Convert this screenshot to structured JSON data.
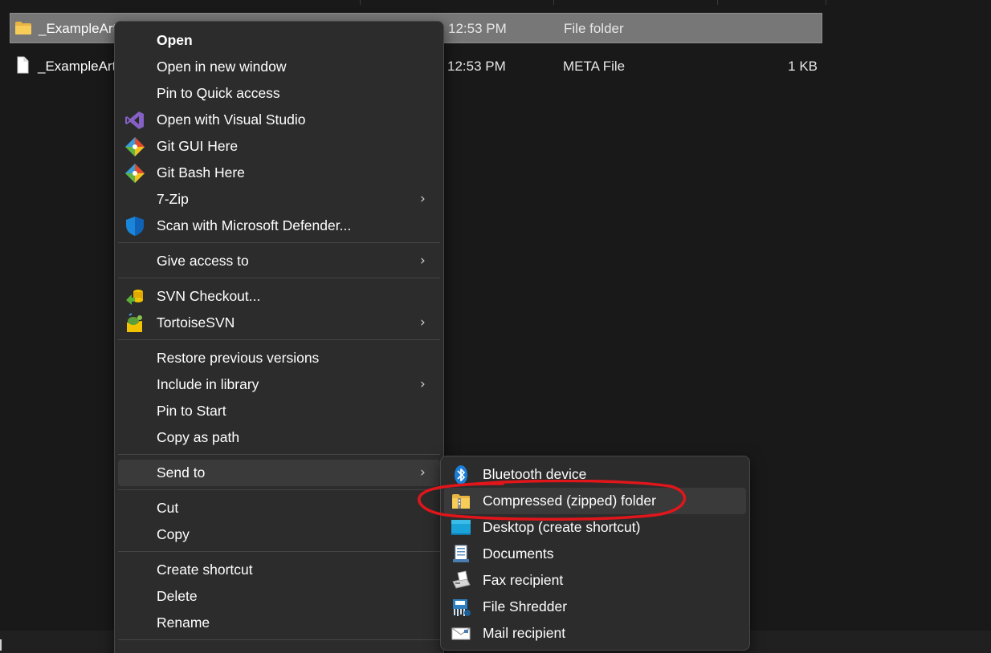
{
  "files": [
    {
      "name": "_ExampleArt",
      "date": "12:53 PM",
      "type": "File folder",
      "size": "",
      "icon": "folder-icon",
      "selected": true
    },
    {
      "name": "_ExampleArt",
      "date": "12:53 PM",
      "type": "META File",
      "size": "1 KB",
      "icon": "file-icon",
      "selected": false
    }
  ],
  "context_menu": {
    "items": [
      {
        "label": "Open",
        "icon": ""
      },
      {
        "label": "Open in new window",
        "icon": ""
      },
      {
        "label": "Pin to Quick access",
        "icon": ""
      },
      {
        "label": "Open with Visual Studio",
        "icon": "visual-studio-icon"
      },
      {
        "label": "Git GUI Here",
        "icon": "git-icon"
      },
      {
        "label": "Git Bash Here",
        "icon": "git-icon"
      },
      {
        "label": "7-Zip",
        "icon": "",
        "submenu": true
      },
      {
        "label": "Scan with Microsoft Defender...",
        "icon": "defender-shield-icon"
      },
      {
        "label": "Give access to",
        "icon": "",
        "submenu": true
      },
      {
        "label": "SVN Checkout...",
        "icon": "svn-checkout-icon"
      },
      {
        "label": "TortoiseSVN",
        "icon": "tortoisesvn-icon",
        "submenu": true
      },
      {
        "label": "Restore previous versions",
        "icon": ""
      },
      {
        "label": "Include in library",
        "icon": "",
        "submenu": true
      },
      {
        "label": "Pin to Start",
        "icon": ""
      },
      {
        "label": "Copy as path",
        "icon": ""
      },
      {
        "label": "Send to",
        "icon": "",
        "submenu": true,
        "hover": true
      },
      {
        "label": "Cut",
        "icon": ""
      },
      {
        "label": "Copy",
        "icon": ""
      },
      {
        "label": "Create shortcut",
        "icon": ""
      },
      {
        "label": "Delete",
        "icon": ""
      },
      {
        "label": "Rename",
        "icon": ""
      }
    ],
    "chevron": "›"
  },
  "send_to_menu": {
    "items": [
      {
        "label": "Bluetooth device",
        "icon": "bluetooth-icon"
      },
      {
        "label": "Compressed (zipped) folder",
        "icon": "zip-folder-icon",
        "hover": true
      },
      {
        "label": "Desktop (create shortcut)",
        "icon": "desktop-icon"
      },
      {
        "label": "Documents",
        "icon": "documents-icon"
      },
      {
        "label": "Fax recipient",
        "icon": "fax-icon"
      },
      {
        "label": "File Shredder",
        "icon": "file-shredder-icon"
      },
      {
        "label": "Mail recipient",
        "icon": "mail-icon"
      }
    ]
  },
  "colors": {
    "background": "#191919",
    "menu_background": "#2c2c2c",
    "selection": "#777777",
    "hover": "#3a3a3a",
    "annotation": "#e0161b"
  }
}
